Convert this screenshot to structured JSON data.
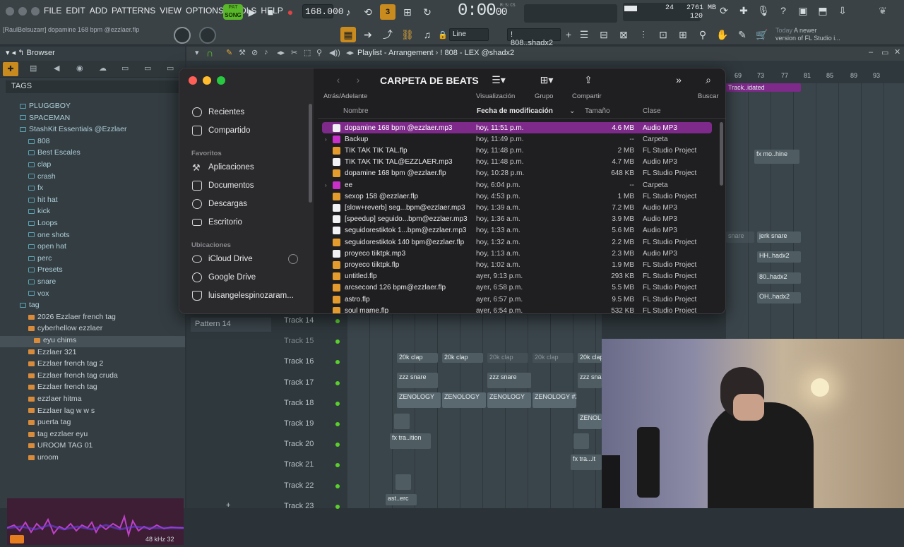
{
  "topbar": {
    "menus": [
      "FILE",
      "EDIT",
      "ADD",
      "PATTERNS",
      "VIEW",
      "OPTIONS",
      "TOOLS",
      "HELP"
    ],
    "song_mode_top": "PAT",
    "song_mode": "SONG",
    "tempo": "168.000",
    "time_display": "0:00",
    "time_frac": "00",
    "time_unit": "M:S:CS",
    "cpu_value": "24",
    "memory": "2761 MB",
    "polyphony": "120",
    "hint_text": "[RaulBelsuzarr] dopamine 168 bpm @ezzlaer.flp",
    "line_select": "Line",
    "pattern_select": "! 808..shadx2",
    "news_date": "Today",
    "news_text": "A newer",
    "news_text2": "version of FL Studio i..."
  },
  "browser": {
    "title": "Browser",
    "tags_label": "TAGS",
    "items": [
      {
        "label": "PLUGGBOY",
        "kind": "folder",
        "indent": 1
      },
      {
        "label": "SPACEMAN",
        "kind": "folder",
        "indent": 1
      },
      {
        "label": "StashKit Essentials @Ezzlaer",
        "kind": "folder",
        "indent": 1
      },
      {
        "label": "808",
        "kind": "folder",
        "indent": 2
      },
      {
        "label": "Best Escales",
        "kind": "folder",
        "indent": 2
      },
      {
        "label": "clap",
        "kind": "folder",
        "indent": 2
      },
      {
        "label": "crash",
        "kind": "folder",
        "indent": 2
      },
      {
        "label": "fx",
        "kind": "folder",
        "indent": 2
      },
      {
        "label": "hit hat",
        "kind": "folder",
        "indent": 2
      },
      {
        "label": "kick",
        "kind": "folder",
        "indent": 2
      },
      {
        "label": "Loops",
        "kind": "folder",
        "indent": 2
      },
      {
        "label": "one shots",
        "kind": "folder",
        "indent": 2
      },
      {
        "label": "open hat",
        "kind": "folder",
        "indent": 2
      },
      {
        "label": "perc",
        "kind": "folder",
        "indent": 2
      },
      {
        "label": "Presets",
        "kind": "folder",
        "indent": 2
      },
      {
        "label": "snare",
        "kind": "folder",
        "indent": 2
      },
      {
        "label": "vox",
        "kind": "folder",
        "indent": 2
      },
      {
        "label": "tag",
        "kind": "folder",
        "indent": 1
      },
      {
        "label": "2026 Ezzlaer french tag",
        "kind": "file",
        "indent": 2
      },
      {
        "label": "cyberhellow ezzlaer",
        "kind": "file",
        "indent": 2
      },
      {
        "label": "eyu chims",
        "kind": "file",
        "indent": 3,
        "selected": true
      },
      {
        "label": "Ezzlaer 321",
        "kind": "file",
        "indent": 2
      },
      {
        "label": "Ezzlaer french tag 2",
        "kind": "file",
        "indent": 2
      },
      {
        "label": "Ezzlaer french tag cruda",
        "kind": "file",
        "indent": 2
      },
      {
        "label": "Ezzlaer french tag",
        "kind": "file",
        "indent": 2
      },
      {
        "label": "ezzlaer hitma",
        "kind": "file",
        "indent": 2
      },
      {
        "label": "Ezzlaer lag w w s",
        "kind": "file",
        "indent": 2
      },
      {
        "label": "puerta tag",
        "kind": "file",
        "indent": 2
      },
      {
        "label": "tag ezzlaer eyu",
        "kind": "file",
        "indent": 2
      },
      {
        "label": "UROOM TAG 01",
        "kind": "file",
        "indent": 2
      },
      {
        "label": "uroom",
        "kind": "file",
        "indent": 2
      }
    ],
    "sample_info": "48 kHz 32"
  },
  "playlist": {
    "title": "Playlist - Arrangement",
    "pattern": "! 808 - LEX @shadx2",
    "ruler": [
      "69",
      "73",
      "77",
      "81",
      "85",
      "89",
      "93"
    ],
    "pattern_row_label": "Pattern 14",
    "tracks": [
      {
        "label": "Track 14"
      },
      {
        "label": "Track 15"
      },
      {
        "label": "Track 16"
      },
      {
        "label": "Track 17"
      },
      {
        "label": "Track 18"
      },
      {
        "label": "Track 19"
      },
      {
        "label": "Track 20"
      },
      {
        "label": "Track 21"
      },
      {
        "label": "Track 22"
      },
      {
        "label": "Track 23"
      }
    ],
    "clips": {
      "clap": "20k clap",
      "snare": "zzz snare",
      "zenology": "ZENOLOGY",
      "zenology2": "ZENOLOGY #2",
      "zenology_short": "ZENOL",
      "fx": "fx tra..ition",
      "fx_short": "fx tra...it",
      "ast": "ast..erc",
      "track_idated": "Track..idated",
      "fx_machine": "fx mo..hine",
      "jerk_snare": "jerk snare",
      "snare_short": "snare",
      "hh": "HH..hadx2",
      "b80": "80..hadx2",
      "oh": "OH..hadx2"
    }
  },
  "finder": {
    "title": "CARPETA DE BEATS",
    "nav_label": "Atrás/Adelante",
    "view_label": "Visualización",
    "group_label": "Grupo",
    "share_label": "Compartir",
    "search_label": "Buscar",
    "sidebar": {
      "recientes": "Recientes",
      "compartido": "Compartido",
      "favoritos_header": "Favoritos",
      "aplicaciones": "Aplicaciones",
      "documentos": "Documentos",
      "descargas": "Descargas",
      "escritorio": "Escritorio",
      "ubicaciones_header": "Ubicaciones",
      "icloud": "iCloud Drive",
      "gdrive": "Google Drive",
      "user": "luisangelespinozaram..."
    },
    "columns": {
      "name": "Nombre",
      "modified": "Fecha de modificación",
      "size": "Tamaño",
      "kind": "Clase"
    },
    "files": [
      {
        "name": "dopamine 168 bpm @ezzlaer.mp3",
        "modified": "hoy, 11:51 p.m.",
        "size": "4.6 MB",
        "kind": "Audio MP3",
        "type": "mp3",
        "selected": true
      },
      {
        "name": "Backup",
        "modified": "hoy, 11:49 p.m.",
        "size": "--",
        "kind": "Carpeta",
        "type": "folder"
      },
      {
        "name": "TIK TAK TIK TAL.flp",
        "modified": "hoy, 11:48 p.m.",
        "size": "2 MB",
        "kind": "FL Studio Project",
        "type": "flp"
      },
      {
        "name": "TIK TAK TIK TAL@EZZLAER.mp3",
        "modified": "hoy, 11:48 p.m.",
        "size": "4.7 MB",
        "kind": "Audio MP3",
        "type": "mp3"
      },
      {
        "name": "dopamine 168 bpm @ezzlaer.flp",
        "modified": "hoy, 10:28 p.m.",
        "size": "648 KB",
        "kind": "FL Studio Project",
        "type": "flp"
      },
      {
        "name": "ee",
        "modified": "hoy, 6:04 p.m.",
        "size": "--",
        "kind": "Carpeta",
        "type": "folder"
      },
      {
        "name": "sexop 158 @ezzlaer.flp",
        "modified": "hoy, 4:53 p.m.",
        "size": "1 MB",
        "kind": "FL Studio Project",
        "type": "flp"
      },
      {
        "name": "[slow+reverb] seg...bpm@ezzlaer.mp3",
        "modified": "hoy, 1:39 a.m.",
        "size": "7.2 MB",
        "kind": "Audio MP3",
        "type": "mp3"
      },
      {
        "name": "[speedup] seguido...bpm@ezzlaer.mp3",
        "modified": "hoy, 1:36 a.m.",
        "size": "3.9 MB",
        "kind": "Audio MP3",
        "type": "mp3"
      },
      {
        "name": "seguidorestiktok 1...bpm@ezzlaer.mp3",
        "modified": "hoy, 1:33 a.m.",
        "size": "5.6 MB",
        "kind": "Audio MP3",
        "type": "mp3"
      },
      {
        "name": "seguidorestiktok 140 bpm@ezzlaer.flp",
        "modified": "hoy, 1:32 a.m.",
        "size": "2.2 MB",
        "kind": "FL Studio Project",
        "type": "flp"
      },
      {
        "name": "proyeco tiiktpk.mp3",
        "modified": "hoy, 1:13 a.m.",
        "size": "2.3 MB",
        "kind": "Audio MP3",
        "type": "mp3"
      },
      {
        "name": "proyeco tiiktpk.flp",
        "modified": "hoy, 1:02 a.m.",
        "size": "1.9 MB",
        "kind": "FL Studio Project",
        "type": "flp"
      },
      {
        "name": "untitled.flp",
        "modified": "ayer, 9:13 p.m.",
        "size": "293 KB",
        "kind": "FL Studio Project",
        "type": "flp"
      },
      {
        "name": "arcsecond 126 bpm@ezzlaer.flp",
        "modified": "ayer, 6:58 p.m.",
        "size": "5.5 MB",
        "kind": "FL Studio Project",
        "type": "flp"
      },
      {
        "name": "astro.flp",
        "modified": "ayer, 6:57 p.m.",
        "size": "9.5 MB",
        "kind": "FL Studio Project",
        "type": "flp"
      },
      {
        "name": "soul mame.flp",
        "modified": "ayer, 6:54 p.m.",
        "size": "532 KB",
        "kind": "FL Studio Project",
        "type": "flp"
      }
    ]
  },
  "colors": {
    "accent_purple": "#7d2a8a",
    "fl_green": "#59b82a",
    "folder_magenta": "#c930c9",
    "flp_orange": "#e39b2e"
  }
}
